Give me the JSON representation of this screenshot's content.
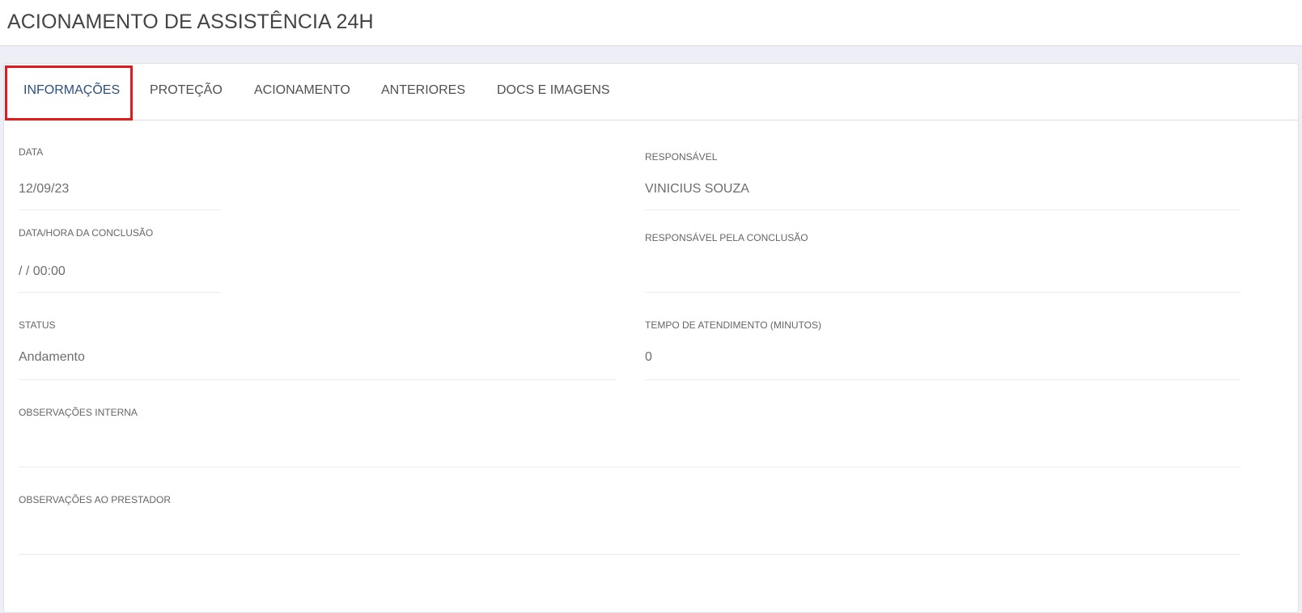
{
  "header": {
    "title": "ACIONAMENTO DE ASSISTÊNCIA 24H"
  },
  "tabs": [
    {
      "label": "INFORMAÇÕES",
      "active": true
    },
    {
      "label": "PROTEÇÃO",
      "active": false
    },
    {
      "label": "ACIONAMENTO",
      "active": false
    },
    {
      "label": "ANTERIORES",
      "active": false
    },
    {
      "label": "DOCS E IMAGENS",
      "active": false
    }
  ],
  "highlight_color": "#e31a1c",
  "accent_color": "#2d4f7c",
  "fields": {
    "data": {
      "label": "DATA",
      "value": "12/09/23"
    },
    "responsavel": {
      "label": "RESPONSÁVEL",
      "value": "VINICIUS SOUZA"
    },
    "data_conclusao": {
      "label": "DATA/HORA DA CONCLUSÃO",
      "value": "/ / 00:00"
    },
    "responsavel_conclusao": {
      "label": "RESPONSÁVEL PELA CONCLUSÃO",
      "value": ""
    },
    "status": {
      "label": "STATUS",
      "value": "Andamento"
    },
    "tempo_atendimento": {
      "label": "TEMPO DE ATENDIMENTO (MINUTOS)",
      "value": "0"
    },
    "obs_interna": {
      "label": "OBSERVAÇÕES INTERNA",
      "value": ""
    },
    "obs_prestador": {
      "label": "OBSERVAÇÕES AO PRESTADOR",
      "value": ""
    }
  }
}
